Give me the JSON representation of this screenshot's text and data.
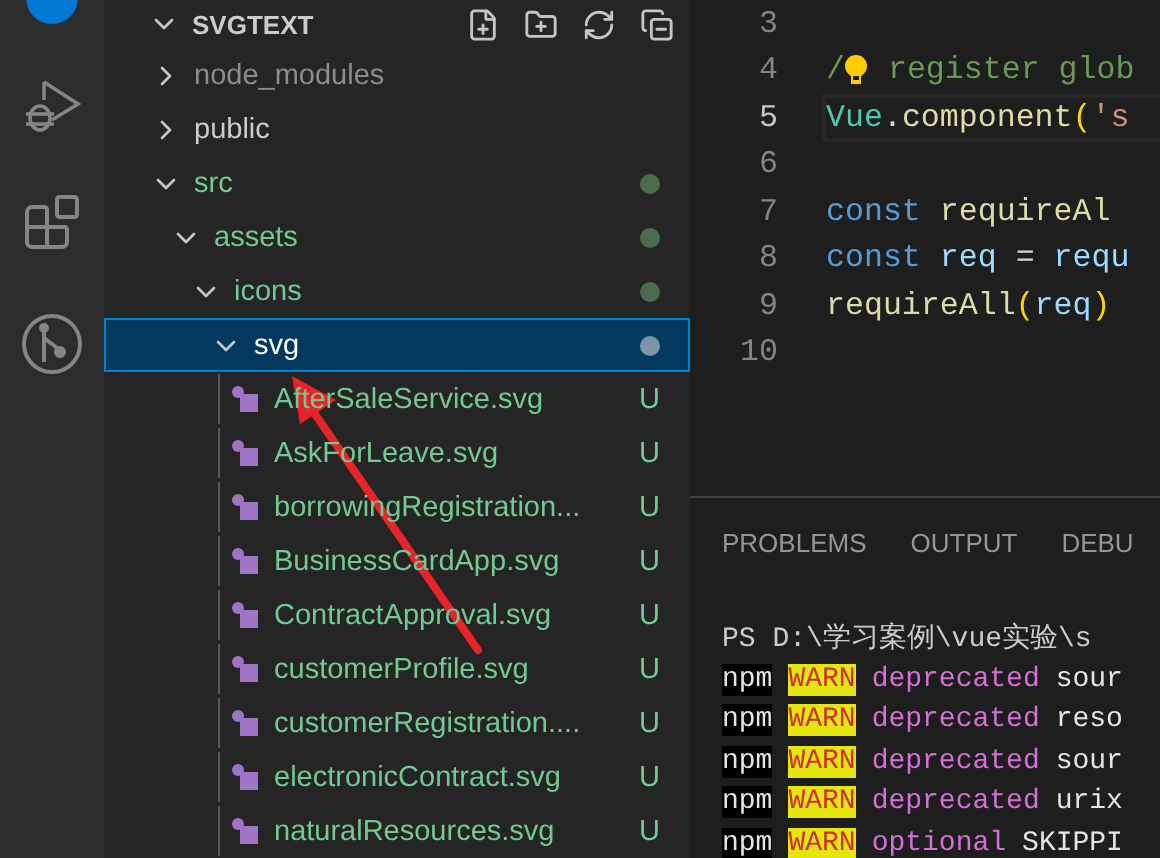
{
  "explorer": {
    "title": "SVGTEXT",
    "tree": [
      {
        "name": "node_modules",
        "kind": "folder",
        "expanded": false,
        "ignored": true,
        "modified": false,
        "selected": false
      },
      {
        "name": "public",
        "kind": "folder",
        "expanded": false,
        "ignored": false,
        "modified": false,
        "selected": false
      },
      {
        "name": "src",
        "kind": "folder",
        "expanded": true,
        "ignored": false,
        "modified": true,
        "selected": false,
        "children": [
          {
            "name": "assets",
            "kind": "folder",
            "expanded": true,
            "ignored": false,
            "modified": true,
            "selected": false,
            "children": [
              {
                "name": "icons",
                "kind": "folder",
                "expanded": true,
                "ignored": false,
                "modified": true,
                "selected": false,
                "children": [
                  {
                    "name": "svg",
                    "kind": "folder",
                    "expanded": true,
                    "ignored": false,
                    "modified": true,
                    "selected": true,
                    "children": [
                      {
                        "name": "AfterSaleService.svg",
                        "kind": "file",
                        "badge": "U",
                        "selected": false
                      },
                      {
                        "name": "AskForLeave.svg",
                        "kind": "file",
                        "badge": "U",
                        "selected": false
                      },
                      {
                        "name": "borrowingRegistration...",
                        "kind": "file",
                        "badge": "U",
                        "selected": false
                      },
                      {
                        "name": "BusinessCardApp.svg",
                        "kind": "file",
                        "badge": "U",
                        "selected": false
                      },
                      {
                        "name": "ContractApproval.svg",
                        "kind": "file",
                        "badge": "U",
                        "selected": false
                      },
                      {
                        "name": "customerProfile.svg",
                        "kind": "file",
                        "badge": "U",
                        "selected": false
                      },
                      {
                        "name": "customerRegistration....",
                        "kind": "file",
                        "badge": "U",
                        "selected": false
                      },
                      {
                        "name": "electronicContract.svg",
                        "kind": "file",
                        "badge": "U",
                        "selected": false
                      },
                      {
                        "name": "naturalResources.svg",
                        "kind": "file",
                        "badge": "U",
                        "selected": false
                      }
                    ]
                  }
                ]
              }
            ]
          }
        ]
      }
    ]
  },
  "editor": {
    "lines": [
      {
        "number": "3",
        "current": false
      },
      {
        "number": "4",
        "current": false,
        "tokens": [
          {
            "kind": "comment",
            "text": "/"
          },
          {
            "kind": "bulb"
          },
          {
            "kind": "comment",
            "text": " register glob"
          }
        ]
      },
      {
        "number": "5",
        "current": true,
        "tokens": [
          {
            "kind": "type",
            "text": "Vue"
          },
          {
            "kind": "punct",
            "text": "."
          },
          {
            "kind": "func",
            "text": "component"
          },
          {
            "kind": "paren",
            "text": "("
          },
          {
            "kind": "string",
            "text": "'s"
          }
        ]
      },
      {
        "number": "6",
        "current": false
      },
      {
        "number": "7",
        "current": false,
        "tokens": [
          {
            "kind": "keyword",
            "text": "const "
          },
          {
            "kind": "func",
            "text": "requireAl"
          }
        ]
      },
      {
        "number": "8",
        "current": false,
        "tokens": [
          {
            "kind": "keyword",
            "text": "const "
          },
          {
            "kind": "var",
            "text": "req"
          },
          {
            "kind": "punct",
            "text": " = "
          },
          {
            "kind": "var",
            "text": "requ"
          }
        ]
      },
      {
        "number": "9",
        "current": false,
        "tokens": [
          {
            "kind": "func",
            "text": "requireAll"
          },
          {
            "kind": "paren",
            "text": "("
          },
          {
            "kind": "var",
            "text": "req"
          },
          {
            "kind": "paren",
            "text": ")"
          }
        ]
      },
      {
        "number": "10",
        "current": false
      }
    ]
  },
  "panel": {
    "tabs": [
      {
        "label": "PROBLEMS",
        "selected": false
      },
      {
        "label": "OUTPUT",
        "selected": false
      },
      {
        "label": "DEBU",
        "selected": false
      }
    ],
    "terminal": {
      "prompt": "PS D:\\学习案例\\vue实验\\s",
      "lines": [
        {
          "tokens": [
            {
              "kind": "npm",
              "text": "npm"
            },
            {
              "kind": "warn",
              "text": "WARN"
            },
            {
              "kind": "level",
              "text": "deprecated"
            },
            {
              "kind": "text",
              "text": "sour"
            }
          ]
        },
        {
          "tokens": [
            {
              "kind": "npm",
              "text": "npm"
            },
            {
              "kind": "warn",
              "text": "WARN"
            },
            {
              "kind": "level",
              "text": "deprecated"
            },
            {
              "kind": "text",
              "text": "reso"
            }
          ]
        },
        {
          "tokens": [
            {
              "kind": "npm",
              "text": "npm"
            },
            {
              "kind": "warn",
              "text": "WARN"
            },
            {
              "kind": "level",
              "text": "deprecated"
            },
            {
              "kind": "text",
              "text": "sour"
            }
          ]
        },
        {
          "tokens": [
            {
              "kind": "npm",
              "text": "npm"
            },
            {
              "kind": "warn",
              "text": "WARN"
            },
            {
              "kind": "level",
              "text": "deprecated"
            },
            {
              "kind": "text",
              "text": "urix"
            }
          ]
        },
        {
          "tokens": [
            {
              "kind": "npm",
              "text": "npm"
            },
            {
              "kind": "warn",
              "text": "WARN"
            },
            {
              "kind": "level",
              "text": "optional"
            },
            {
              "kind": "text",
              "text": "SKIPPI"
            }
          ]
        }
      ]
    }
  }
}
